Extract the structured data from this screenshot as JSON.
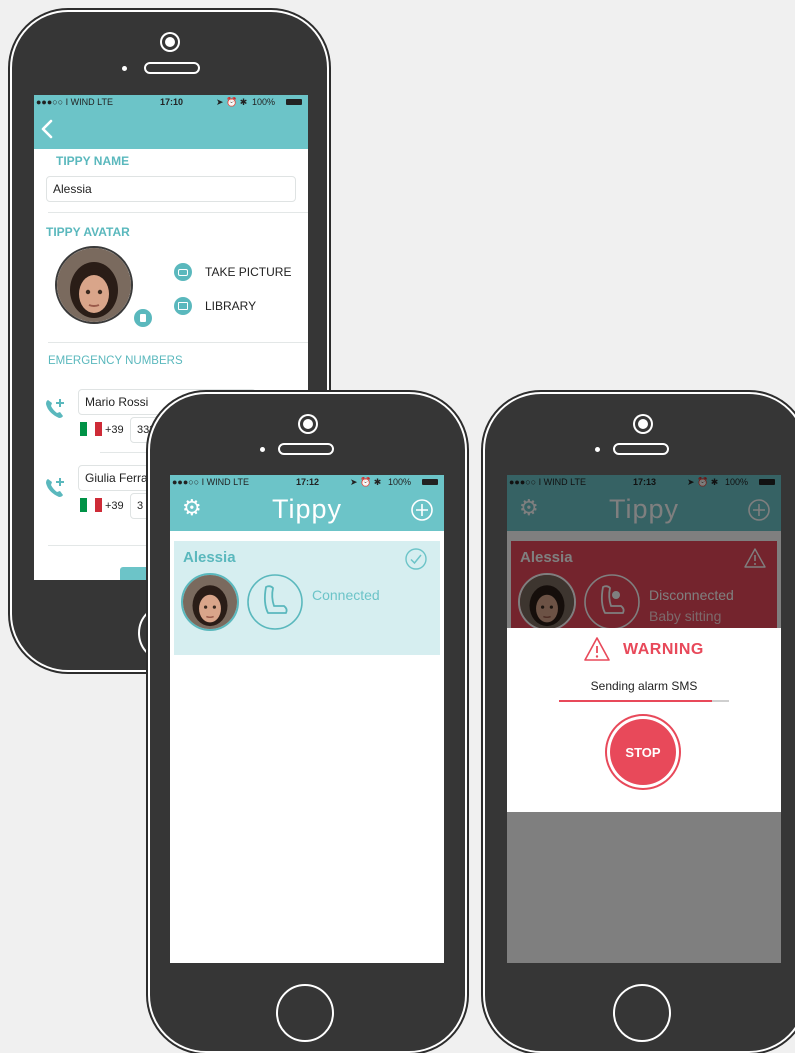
{
  "phone1": {
    "status": {
      "carrier": "●●●○○ I WIND  LTE",
      "time": "17:10",
      "battery": "100%"
    },
    "nav": {
      "back_icon": "chevron-left-icon"
    },
    "tippy_name": {
      "label": "TIPPY NAME",
      "value": "Alessia"
    },
    "tippy_avatar": {
      "label": "TIPPY AVATAR",
      "take_picture": "TAKE PICTURE",
      "library": "LIBRARY"
    },
    "emergency": {
      "label": "EMERGENCY NUMBERS",
      "contacts": [
        {
          "name": "Mario Rossi",
          "prefix": "+39",
          "number": "333"
        },
        {
          "name": "Giulia Ferra",
          "prefix": "+39",
          "number": "3"
        }
      ]
    }
  },
  "phone2": {
    "status": {
      "carrier": "●●●○○ I WIND  LTE",
      "time": "17:12",
      "battery": "100%"
    },
    "nav": {
      "title": "Tippy",
      "settings_icon": "gear-icon",
      "add_icon": "plus-circle-icon"
    },
    "card": {
      "name": "Alessia",
      "status": "Connected",
      "status_icon": "check-circle-icon",
      "seat_icon": "car-seat-icon"
    }
  },
  "phone3": {
    "status": {
      "carrier": "●●●○○ I WIND  LTE",
      "time": "17:13",
      "battery": "100%"
    },
    "nav": {
      "title": "Tippy",
      "settings_icon": "gear-icon",
      "add_icon": "plus-circle-icon"
    },
    "card": {
      "name": "Alessia",
      "status": "Disconnected",
      "substatus": "Baby sitting",
      "warning_icon": "warning-triangle-icon"
    },
    "alert": {
      "title": "WARNING",
      "message": "Sending alarm SMS",
      "stop_label": "STOP"
    }
  },
  "colors": {
    "teal": "#6cc4c8",
    "teal_text": "#5ab8bd",
    "card_bg": "#d6eef0",
    "alert_red": "#e8495a",
    "phone_body": "#363636"
  }
}
